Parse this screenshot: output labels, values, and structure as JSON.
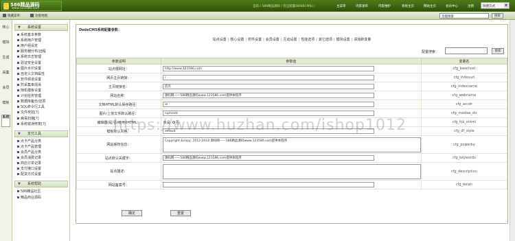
{
  "header": {
    "logo_title": "586精品源码",
    "logo_url": "www.123586.com",
    "breadcrumb": "当前 / 586精品源码 / 完全配置(8080CMS) /",
    "nav": [
      "主菜单",
      "内容发布",
      "内容维护",
      "系统主页",
      "网站主页",
      "会员中心",
      "注销"
    ],
    "quick_menu": "快捷方式"
  },
  "subbar": {
    "hide_menu": "隐藏菜单",
    "func_map": "功能地图",
    "search_placeholder": "功能搜索",
    "search_button": "搜索"
  },
  "left_tabs": [
    "核心",
    "模块",
    "生成",
    "采集",
    "会员",
    "模板",
    "系统"
  ],
  "sidebar": {
    "sections": [
      {
        "title": "系统设置",
        "items": [
          "系统基本参数",
          "系统用户管理",
          "用户组设定",
          "服务器分布/远程",
          "系统日志管理",
          "验证安全设置",
          "图片水印设置",
          "自定义文档属性",
          "软件频道设置",
          "防采集串混淆",
          "随机模板设置",
          "计划任务管理",
          "数据库备份/还原",
          "SQL命令行工具",
          "文件校验[?]",
          "病毒扫描[?]",
          "系统错误修复[?]"
        ]
      },
      {
        "title": "支付工具",
        "items": [
          "点卡产品分类",
          "点卡产品管理",
          "会员产品分类",
          "会员消费记录",
          "商店订单记录",
          "支付接口设置",
          "配货方式设置"
        ]
      },
      {
        "title": "系统帮助",
        "items": [
          "586精品社区",
          "精品商业源码"
        ]
      }
    ]
  },
  "main": {
    "title": "DedeCMS系统配置参数：",
    "tabs": [
      "站点设置",
      "核心设置",
      "附件设置",
      "会员设置",
      "互动设置",
      "性能选项",
      "其它选项",
      "模块设置",
      "添加新变量"
    ],
    "search_label": "配置搜索：",
    "search_button": "搜索",
    "columns": [
      "参数说明",
      "参数值",
      "变量名"
    ],
    "rows": [
      {
        "label": "站点根网址：",
        "value": "http://www.123586.com",
        "key": "cfg_basehost",
        "kind": "input"
      },
      {
        "label": "网页主页链接：",
        "value": "/",
        "key": "cfg_indexurl",
        "kind": "input"
      },
      {
        "label": "主页链接名：",
        "value": "首页",
        "key": "cfg_indexname",
        "kind": "input"
      },
      {
        "label": "网站名称：",
        "value": "源码网——586精品源码www.123586.com提供本程序",
        "key": "cfg_webname",
        "kind": "input"
      },
      {
        "label": "文档HTML默认保存路径：",
        "value": "/a",
        "key": "cfg_arcdir",
        "kind": "input"
      },
      {
        "label": "图片/上传文件默认路径：",
        "value": "/uploads",
        "key": "cfg_medias_dir",
        "kind": "input"
      },
      {
        "label": "编辑器(是/否)使用XHTML：",
        "value": "",
        "key": "cfg_fck_xhtml",
        "kind": "radio",
        "options": [
          "是",
          "否"
        ]
      },
      {
        "label": "模板默认风格：",
        "value": "default",
        "key": "cfg_df_style",
        "kind": "input"
      },
      {
        "label": "网站版权信息：",
        "value": "Copyright &copy; 2012-2018 源码网——586精品源码www.123586.com提供本程序",
        "key": "cfg_powerby",
        "kind": "textarea"
      },
      {
        "label": "站点默认关键字：",
        "value": "源码网——586精品源码www.123586.com提供本程序",
        "key": "cfg_keywords",
        "kind": "input"
      },
      {
        "label": "站点描述：",
        "value": "",
        "key": "cfg_description",
        "kind": "textarea"
      },
      {
        "label": "网站备案号：",
        "value": "",
        "key": "cfg_beian",
        "kind": "input"
      }
    ],
    "ok_button": "确定",
    "reset_button": "重置"
  },
  "watermark": "https://www.huzhan.com/ishop1012"
}
